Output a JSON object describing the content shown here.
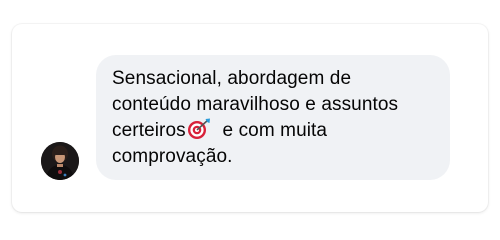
{
  "comment": {
    "avatar_icon": "user-avatar-photo",
    "text_before_emoji": "Sensacional, abordagem de\nconteúdo maravilhoso e assuntos\ncerteiros",
    "emoji_icon": "direct-hit-target-icon",
    "text_after_emoji": "  e com muita\ncomprovação."
  },
  "colors": {
    "bubble_background": "#f0f2f5",
    "text": "#050505",
    "target_red": "#d8213a",
    "dart_blue": "#2a9bd8"
  }
}
